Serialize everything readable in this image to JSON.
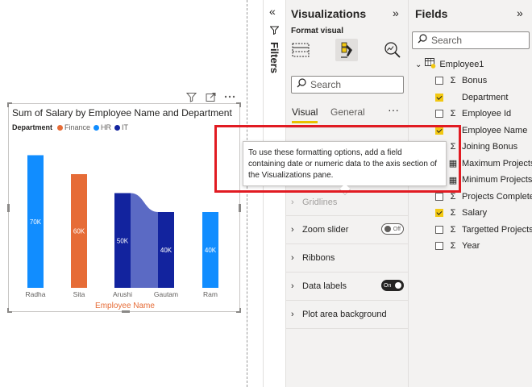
{
  "canvas": {
    "visual_header": {
      "filter_icon": "filter-icon",
      "focus_icon": "focus-mode-icon",
      "more_icon": "more-options-icon"
    }
  },
  "chart_data": {
    "type": "bar",
    "title": "Sum of Salary by Employee Name and Department",
    "xlabel": "Employee Name",
    "ylabel": "",
    "legend": {
      "title": "Department",
      "position": "top-left",
      "entries": [
        {
          "name": "Finance",
          "color": "#e66c37"
        },
        {
          "name": "HR",
          "color": "#118dff"
        },
        {
          "name": "IT",
          "color": "#12239e"
        }
      ]
    },
    "grid": false,
    "ylim": [
      0,
      80
    ],
    "categories": [
      "Radha",
      "Sita",
      "Arushi",
      "Gautam",
      "Ram"
    ],
    "bars": [
      {
        "category": "Radha",
        "department": "HR",
        "value": 70,
        "label": "70K"
      },
      {
        "category": "Sita",
        "department": "Finance",
        "value": 60,
        "label": "60K"
      },
      {
        "category": "Arushi",
        "department": "IT",
        "value": 50,
        "label": "50K"
      },
      {
        "category": "Gautam",
        "department": "IT",
        "value": 40,
        "label": "40K"
      },
      {
        "category": "Ram",
        "department": "HR",
        "value": 40,
        "label": "40K"
      }
    ],
    "ribbon": {
      "from": "Arushi",
      "to": "Gautam",
      "color": "#5b6ac4"
    }
  },
  "filters": {
    "label": "Filters",
    "collapse_icon": "double-chevron-left-icon",
    "funnel_icon": "funnel-icon"
  },
  "visualizations": {
    "title": "Visualizations",
    "expand_icon": "double-chevron-right-icon",
    "format_visual_label": "Format visual",
    "search_placeholder": "Search",
    "tabs": {
      "visual": "Visual",
      "general": "General",
      "more": "···"
    },
    "sections": [
      {
        "label": "Gridlines",
        "disabled": true
      },
      {
        "label": "Zoom slider",
        "toggle": "Off"
      },
      {
        "label": "Ribbons"
      },
      {
        "label": "Data labels",
        "toggle": "On"
      },
      {
        "label": "Plot area background"
      }
    ]
  },
  "tooltip": {
    "text": "To use these formatting options, add a field containing date or numeric data to the axis section of the Visualizations pane."
  },
  "fields": {
    "title": "Fields",
    "expand_icon": "double-chevron-right-icon",
    "search_placeholder": "Search",
    "table": "Employee1",
    "items": [
      {
        "label": "Bonus",
        "type": "sum",
        "checked": false
      },
      {
        "label": "Department",
        "type": "text",
        "checked": true
      },
      {
        "label": "Employee Id",
        "type": "sum",
        "checked": false
      },
      {
        "label": "Employee Name",
        "type": "text",
        "checked": true
      },
      {
        "label": "Joining Bonus",
        "type": "sum",
        "checked": false
      },
      {
        "label": "Maximum Projects",
        "type": "calc",
        "checked": false
      },
      {
        "label": "Minimum Projects",
        "type": "calc",
        "checked": false
      },
      {
        "label": "Projects Completed",
        "type": "sum",
        "checked": false
      },
      {
        "label": "Salary",
        "type": "sum",
        "checked": true
      },
      {
        "label": "Targetted Projects",
        "type": "sum",
        "checked": false
      },
      {
        "label": "Year",
        "type": "sum",
        "checked": false
      }
    ]
  }
}
